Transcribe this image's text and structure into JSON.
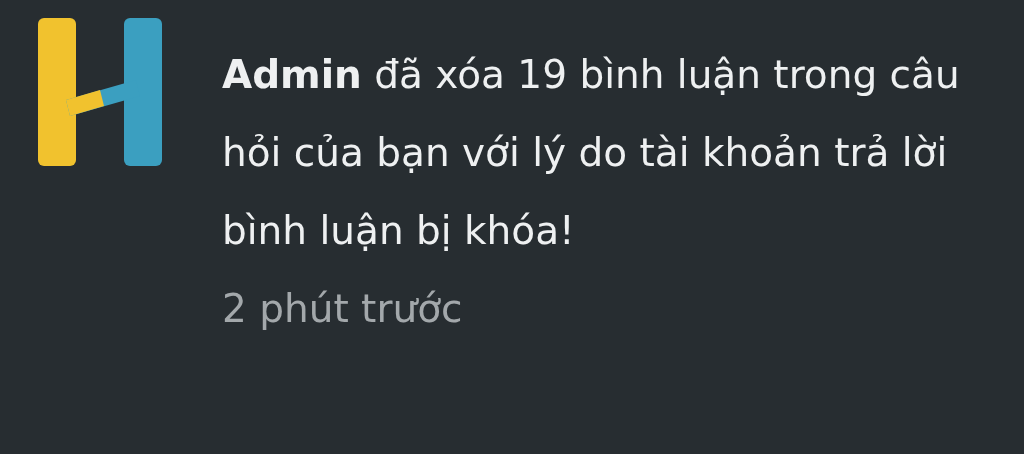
{
  "notification": {
    "message": "**Admin** đã xóa 19 bình luận trong câu hỏi của bạn với lý do tài khoản trả lời bình luận bị khóa!",
    "time": "2 phút trước"
  }
}
